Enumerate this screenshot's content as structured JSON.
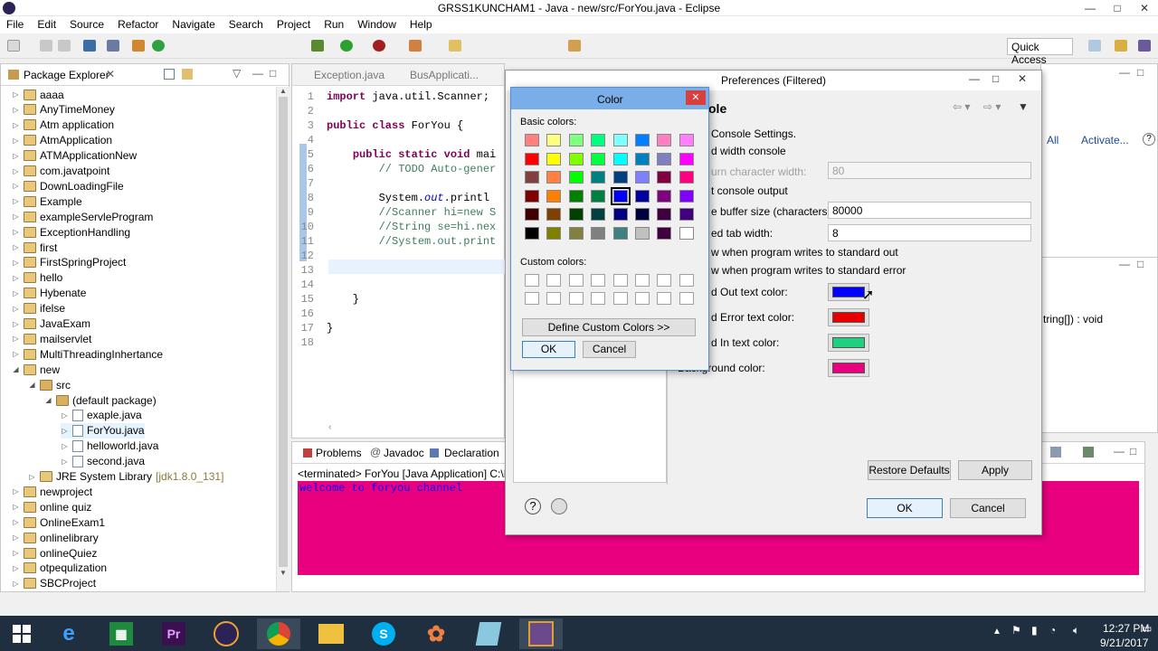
{
  "window": {
    "title": "GRSS1KUNCHAM1 - Java - new/src/ForYou.java - Eclipse"
  },
  "menu": [
    "File",
    "Edit",
    "Source",
    "Refactor",
    "Navigate",
    "Search",
    "Project",
    "Run",
    "Window",
    "Help"
  ],
  "toolbar": {
    "quick_access": "Quick Access"
  },
  "package_explorer": {
    "title": "Package Explorer",
    "items": [
      {
        "label": "aaaa"
      },
      {
        "label": "AnyTimeMoney"
      },
      {
        "label": "Atm application"
      },
      {
        "label": "AtmApplication"
      },
      {
        "label": "ATMApplicationNew"
      },
      {
        "label": "com.javatpoint"
      },
      {
        "label": "DownLoadingFile"
      },
      {
        "label": "Example"
      },
      {
        "label": "exampleServleProgram"
      },
      {
        "label": "ExceptionHandling"
      },
      {
        "label": "first"
      },
      {
        "label": "FirstSpringProject"
      },
      {
        "label": "hello"
      },
      {
        "label": "Hybenate"
      },
      {
        "label": "ifelse"
      },
      {
        "label": "JavaExam"
      },
      {
        "label": "mailservlet"
      },
      {
        "label": "MultiThreadingInhertance"
      },
      {
        "label": "new"
      },
      {
        "label": "src"
      },
      {
        "label": "(default package)"
      },
      {
        "label": "exaple.java"
      },
      {
        "label": "ForYou.java"
      },
      {
        "label": "helloworld.java"
      },
      {
        "label": "second.java"
      },
      {
        "label": "JRE System Library",
        "suffix": "[jdk1.8.0_131]"
      },
      {
        "label": "newproject"
      },
      {
        "label": "online quiz"
      },
      {
        "label": "OnlineExam1"
      },
      {
        "label": "onlinelibrary"
      },
      {
        "label": "onlineQuiez"
      },
      {
        "label": "otpequlization"
      },
      {
        "label": "SBCProject"
      }
    ]
  },
  "editor": {
    "tabs": [
      "Exception.java",
      "BusApplicati..."
    ],
    "lines": [
      {
        "n": "1",
        "parts": [
          [
            "kw",
            "import"
          ],
          [
            "t",
            " java.util.Scanner;"
          ]
        ]
      },
      {
        "n": "2",
        "parts": []
      },
      {
        "n": "3",
        "parts": [
          [
            "kw",
            "public class"
          ],
          [
            "t",
            " ForYou {"
          ]
        ]
      },
      {
        "n": "4",
        "parts": []
      },
      {
        "n": "5",
        "parts": [
          [
            "t",
            "    "
          ],
          [
            "kw",
            "public static void"
          ],
          [
            "t",
            " mai"
          ]
        ]
      },
      {
        "n": "6",
        "parts": [
          [
            "cm",
            "        // TODO Auto-gener"
          ]
        ]
      },
      {
        "n": "7",
        "parts": []
      },
      {
        "n": "8",
        "parts": [
          [
            "t",
            "        System."
          ],
          [
            "fld",
            "out"
          ],
          [
            "t",
            ".printl"
          ]
        ]
      },
      {
        "n": "9",
        "parts": [
          [
            "cm",
            "        //Scanner hi=new S"
          ]
        ]
      },
      {
        "n": "10",
        "parts": [
          [
            "cm",
            "        //String se=hi.nex"
          ]
        ]
      },
      {
        "n": "11",
        "parts": [
          [
            "cm",
            "        //System.out.print"
          ]
        ]
      },
      {
        "n": "12",
        "parts": []
      },
      {
        "n": "13",
        "parts": []
      },
      {
        "n": "14",
        "parts": []
      },
      {
        "n": "15",
        "parts": [
          [
            "t",
            "    }"
          ]
        ]
      },
      {
        "n": "16",
        "parts": []
      },
      {
        "n": "17",
        "parts": [
          [
            "t",
            "}"
          ]
        ]
      },
      {
        "n": "18",
        "parts": []
      }
    ]
  },
  "bottom": {
    "tabs": [
      "Problems",
      "Javadoc",
      "Declaration"
    ],
    "terminated": "<terminated> ForYou [Java Application] C:\\Pr",
    "console_output": "welcome to foryou channel",
    "console_bg": "#e8007f",
    "console_fg": "#0000ff"
  },
  "right_view": {
    "all": "All",
    "activate": "Activate...",
    "method": "tring[]) : void"
  },
  "prefs": {
    "title": "Preferences (Filtered)",
    "section": "ole",
    "console_settings": "Console Settings.",
    "fixed_width": "d width console",
    "max_char_width_label": "urn character width:",
    "max_char_width_value": "80",
    "limit_output": "t console output",
    "buffer_label": "e buffer size (characters):",
    "buffer_value": "80000",
    "tab_label": "ed tab width:",
    "tab_value": "8",
    "show_out": "w when program writes to standard out",
    "show_err": "w when program writes to standard error",
    "out_color_label": "d Out text color:",
    "err_color_label": "d Error text color:",
    "in_color_label": "d In text color:",
    "bg_color_label": "Background color:",
    "out_color": "#0000ff",
    "err_color": "#e80000",
    "in_color": "#20d080",
    "bg_color": "#e8007f",
    "restore": "Restore Defaults",
    "apply": "Apply",
    "ok": "OK",
    "cancel": "Cancel"
  },
  "color_dialog": {
    "title": "Color",
    "basic_label": "Basic colors:",
    "custom_label": "Custom colors:",
    "define": "Define Custom Colors >>",
    "ok": "OK",
    "cancel": "Cancel",
    "basic_colors": [
      [
        "#ff8080",
        "#ffff80",
        "#80ff80",
        "#00ff80",
        "#80ffff",
        "#0080ff",
        "#ff80c0",
        "#ff80ff"
      ],
      [
        "#ff0000",
        "#ffff00",
        "#80ff00",
        "#00ff40",
        "#00ffff",
        "#0080c0",
        "#8080c0",
        "#ff00ff"
      ],
      [
        "#804040",
        "#ff8040",
        "#00ff00",
        "#008080",
        "#004080",
        "#8080ff",
        "#800040",
        "#ff0080"
      ],
      [
        "#800000",
        "#ff8000",
        "#008000",
        "#008040",
        "#0000ff",
        "#0000a0",
        "#800080",
        "#8000ff"
      ],
      [
        "#400000",
        "#804000",
        "#004000",
        "#004040",
        "#000080",
        "#000040",
        "#400040",
        "#400080"
      ],
      [
        "#000000",
        "#808000",
        "#808040",
        "#808080",
        "#408080",
        "#c0c0c0",
        "#400040",
        "#ffffff"
      ]
    ],
    "selected": [
      3,
      4
    ]
  },
  "clock": {
    "time": "12:27 PM",
    "date": "9/21/2017"
  }
}
